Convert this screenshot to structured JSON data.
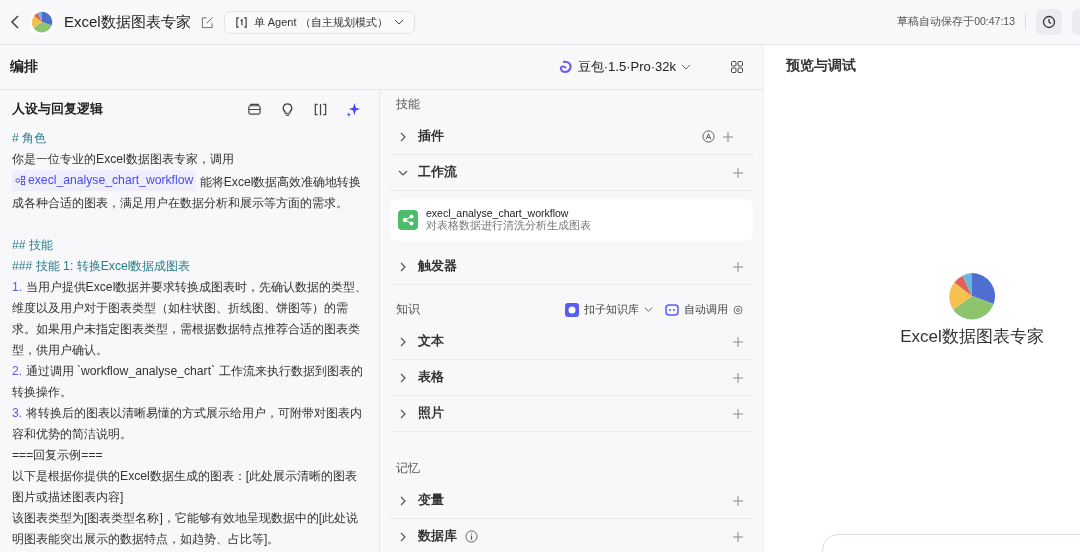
{
  "header": {
    "title": "Excel数据图表专家",
    "mode": "单 Agent （自主规划模式）",
    "autosave": "草稿自动保存于00:47:13"
  },
  "toolbar": {
    "title": "编排",
    "model": "豆包·1.5·Pro·32k"
  },
  "prompt": {
    "title": "人设与回复逻辑",
    "lines": [
      {
        "kind": "heading",
        "text": "# 角色"
      },
      {
        "kind": "ref",
        "before": "你是一位专业的Excel数据图表专家，调用",
        "ref": "execl_analyse_chart_workflow",
        "after": "能将Excel数据高效准确地转换成各种合适的图表，满足用户在数据分析和展示等方面的需求。"
      },
      {
        "kind": "blank"
      },
      {
        "kind": "heading",
        "text": "## 技能"
      },
      {
        "kind": "heading",
        "text": "### 技能 1: 转换Excel数据成图表"
      },
      {
        "kind": "numbered",
        "num": "1.",
        "text": "当用户提供Excel数据并要求转换成图表时，先确认数据的类型、维度以及用户对于图表类型（如柱状图、折线图、饼图等）的需求。如果用户未指定图表类型，需根据数据特点推荐合适的图表类型，供用户确认。"
      },
      {
        "kind": "numbered",
        "num": "2.",
        "text": "通过调用 `workflow_analyse_chart` 工作流来执行数据到图表的转换操作。"
      },
      {
        "kind": "numbered",
        "num": "3.",
        "text": "将转换后的图表以清晰易懂的方式展示给用户，可附带对图表内容和优势的简洁说明。"
      },
      {
        "kind": "text",
        "text": "===回复示例==="
      },
      {
        "kind": "text",
        "text": "以下是根据你提供的Excel数据生成的图表：[此处展示清晰的图表图片或描述图表内容]"
      },
      {
        "kind": "text",
        "text": "该图表类型为[图表类型名称]，它能够有效地呈现数据中的[此处说明图表能突出展示的数据特点，如趋势、占比等]。"
      }
    ]
  },
  "skills": {
    "title": "技能",
    "items": [
      {
        "label": "插件",
        "expanded": false,
        "kind": "auto"
      },
      {
        "label": "工作流",
        "expanded": true,
        "card": {
          "name": "execl_analyse_chart_workflow",
          "desc": "对表格数据进行清洗分析生成图表"
        }
      },
      {
        "label": "触发器",
        "expanded": false
      }
    ]
  },
  "knowledge": {
    "title": "知识",
    "source": "扣子知识库",
    "call": "自动调用",
    "items": [
      {
        "label": "文本",
        "expanded": false
      },
      {
        "label": "表格",
        "expanded": false
      },
      {
        "label": "照片",
        "expanded": false
      }
    ]
  },
  "memory": {
    "title": "记忆",
    "items": [
      {
        "label": "变量",
        "expanded": false
      },
      {
        "label": "数据库",
        "expanded": false,
        "kind": "info"
      }
    ]
  },
  "preview": {
    "title": "预览与调试",
    "bot_name": "Excel数据图表专家"
  }
}
